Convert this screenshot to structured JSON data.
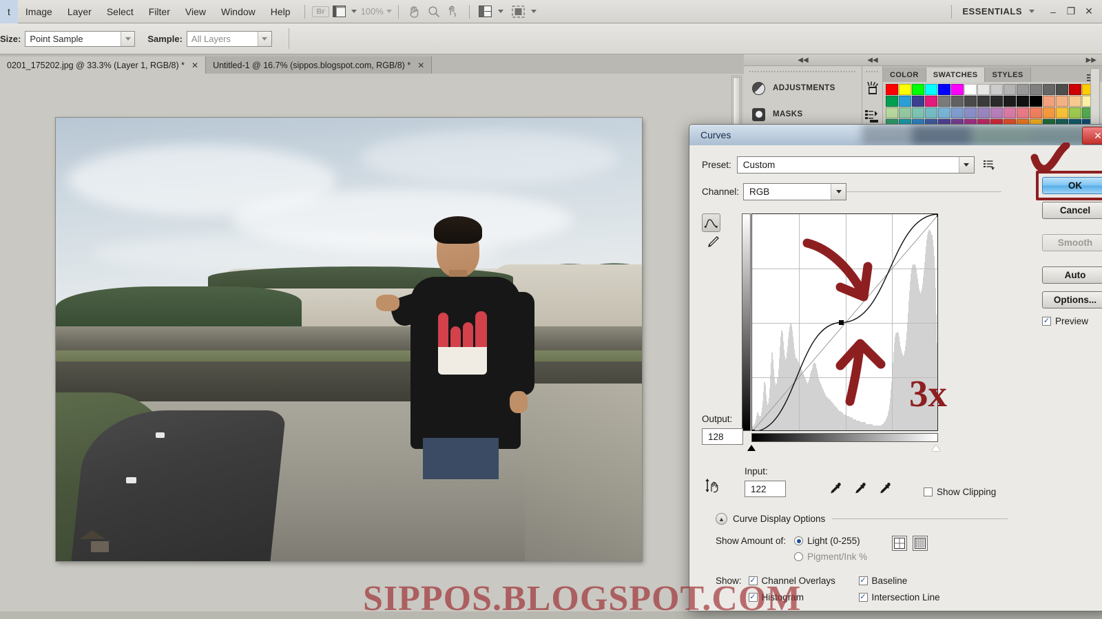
{
  "app": {
    "menu_items": [
      "t",
      "Image",
      "Layer",
      "Select",
      "Filter",
      "View",
      "Window",
      "Help"
    ],
    "bridge_badge": "Br",
    "zoom_level": "100%",
    "workspace": "ESSENTIALS",
    "window_buttons": {
      "minimize": "–",
      "restore": "❐",
      "close": "✕"
    }
  },
  "options_bar": {
    "sample_size_label": "Size:",
    "sample_size_value": "Point Sample",
    "sample_label": "Sample:",
    "sample_value": "All Layers"
  },
  "document_tabs": [
    {
      "label": "0201_175202.jpg @ 33.3% (Layer 1, RGB/8) *",
      "close": "✕",
      "active": true
    },
    {
      "label": "Untitled-1 @ 16.7% (sippos.blogspot.com, RGB/8) *",
      "close": "✕",
      "active": false
    }
  ],
  "watermark": "SIPPOS.BLOGSPOT.COM",
  "panels": {
    "icon_items": [
      {
        "label": "ADJUSTMENTS",
        "icon": "adjustments-icon"
      },
      {
        "label": "MASKS",
        "icon": "masks-icon"
      }
    ],
    "tool_icons": [
      "brushes-icon",
      "tool-presets-icon"
    ],
    "swatch_tabs": [
      "COLOR",
      "SWATCHES",
      "STYLES"
    ],
    "active_swatch_tab": "SWATCHES",
    "collapse_arrows": "◀◀",
    "expand_arrows": "▶▶",
    "panel_menu": "≡",
    "swatch_rows": [
      [
        "#ff0000",
        "#ffff00",
        "#00ff00",
        "#00ffff",
        "#0000ff",
        "#ff00ff",
        "#ffffff",
        "#e6e6e6",
        "#cccccc",
        "#b3b3b3",
        "#999999",
        "#808080",
        "#666666",
        "#4d4d4d",
        "#cc0000",
        "#ffcc00"
      ],
      [
        "#009e4f",
        "#2a9fd6",
        "#3b3f8f",
        "#e5197b",
        "#7a7a7a",
        "#616161",
        "#4a4a4a",
        "#3a3a3a",
        "#2b2b2b",
        "#1c1c1c",
        "#111111",
        "#000000",
        "#f4a07a",
        "#f3b184",
        "#f6c98f",
        "#fbf0a4"
      ],
      [
        "#b9d8a0",
        "#93c9a1",
        "#7fc4b2",
        "#74bcc6",
        "#79b3d6",
        "#7f9ed0",
        "#8a8fc8",
        "#9c86c0",
        "#b87fba",
        "#d97ba5",
        "#e87a86",
        "#ef7f5e",
        "#f79a3d",
        "#f7c13a",
        "#9ec94e",
        "#53a851"
      ],
      [
        "#2e9e6b",
        "#1c9fae",
        "#2f85c4",
        "#3f5fa8",
        "#51449c",
        "#7b3f9c",
        "#a8338c",
        "#c42a6a",
        "#d62b3a",
        "#e8522a",
        "#f07c22",
        "#f4b223",
        "#1f6e3a",
        "#17625a",
        "#125e6e",
        "#0f4e74"
      ]
    ]
  },
  "curves_dialog": {
    "title": "Curves",
    "close": "✕",
    "preset_label": "Preset:",
    "preset_value": "Custom",
    "preset_menu_icon": "preset-menu-icon",
    "channel_label": "Channel:",
    "channel_value": "RGB",
    "output_label": "Output:",
    "output_value": "128",
    "input_label": "Input:",
    "input_value": "122",
    "show_clipping_label": "Show Clipping",
    "show_clipping_checked": false,
    "curve_tool_icon": "curve-edit-icon",
    "pencil_tool_icon": "pencil-draw-icon",
    "target_adjust_icon": "target-adjustment-icon",
    "eyedroppers": [
      "black-point-eyedropper",
      "gray-point-eyedropper",
      "white-point-eyedropper"
    ],
    "curve_display_options_label": "Curve Display Options",
    "show_amount_label": "Show Amount of:",
    "amount_options": [
      {
        "label": "Light  (0-255)",
        "selected": true
      },
      {
        "label": "Pigment/Ink %",
        "selected": false
      }
    ],
    "grid_icons": [
      "quarter-grid-icon",
      "tenth-grid-icon"
    ],
    "show_label": "Show:",
    "show_checkboxes": [
      {
        "label": "Channel Overlays",
        "checked": true
      },
      {
        "label": "Baseline",
        "checked": true
      },
      {
        "label": "Histogram",
        "checked": true
      },
      {
        "label": "Intersection Line",
        "checked": true
      }
    ],
    "buttons": [
      {
        "label": "OK",
        "state": "default-highlighted"
      },
      {
        "label": "Cancel",
        "state": "normal"
      },
      {
        "label": "Smooth",
        "state": "disabled"
      },
      {
        "label": "Auto",
        "state": "normal"
      },
      {
        "label": "Options...",
        "state": "normal"
      }
    ],
    "preview_label": "Preview",
    "preview_checked": true,
    "annotation_text": "3x",
    "annotation_color": "#8e1f21"
  },
  "curve_data": {
    "type": "line",
    "xlabel": "Input",
    "ylabel": "Output",
    "xlim": [
      0,
      255
    ],
    "ylim": [
      0,
      255
    ],
    "grid": true,
    "grid_divisions": 4,
    "control_points": [
      {
        "input": 0,
        "output": 0
      },
      {
        "input": 122,
        "output": 128
      },
      {
        "input": 255,
        "output": 255
      }
    ],
    "baseline": {
      "from": [
        0,
        0
      ],
      "to": [
        255,
        255
      ]
    },
    "histogram": [
      2,
      3,
      3,
      4,
      5,
      7,
      9,
      11,
      10,
      9,
      8,
      9,
      11,
      14,
      18,
      24,
      30,
      28,
      22,
      18,
      16,
      15,
      17,
      20,
      26,
      34,
      42,
      48,
      44,
      38,
      33,
      30,
      28,
      27,
      29,
      33,
      38,
      45,
      52,
      58,
      62,
      60,
      55,
      50,
      46,
      44,
      43,
      45,
      48,
      52,
      57,
      61,
      64,
      66,
      65,
      62,
      58,
      54,
      50,
      47,
      45,
      44,
      43,
      42,
      41,
      40,
      39,
      38,
      37,
      36,
      35,
      34,
      33,
      32,
      31,
      30,
      29,
      29,
      30,
      31,
      33,
      35,
      37,
      39,
      41,
      42,
      42,
      41,
      39,
      37,
      35,
      33,
      31,
      30,
      29,
      28,
      27,
      26,
      25,
      24,
      23,
      22,
      21,
      21,
      20,
      20,
      19,
      19,
      18,
      18,
      17,
      17,
      16,
      16,
      15,
      15,
      14,
      14,
      13,
      13,
      12,
      12,
      12,
      11,
      11,
      11,
      10,
      10,
      10,
      10,
      9,
      9,
      9,
      9,
      8,
      8,
      8,
      8,
      8,
      7,
      7,
      7,
      7,
      7,
      6,
      6,
      6,
      6,
      6,
      6,
      5,
      5,
      5,
      5,
      5,
      5,
      5,
      4,
      4,
      4,
      4,
      4,
      4,
      4,
      4,
      4,
      4,
      3,
      3,
      3,
      3,
      3,
      3,
      3,
      3,
      3,
      3,
      3,
      3,
      3,
      4,
      4,
      4,
      5,
      5,
      6,
      7,
      8,
      9,
      11,
      13,
      16,
      20,
      25,
      30,
      36,
      42,
      48,
      54,
      58,
      60,
      61,
      60,
      58,
      55,
      52,
      50,
      48,
      47,
      46,
      46,
      47,
      49,
      52,
      56,
      61,
      67,
      73,
      80,
      86,
      92,
      97,
      100,
      102,
      103,
      103,
      102,
      100,
      97,
      94,
      91,
      88,
      86,
      85,
      85,
      86,
      88,
      91,
      95,
      99,
      104,
      109,
      114,
      118,
      121,
      123,
      124,
      124,
      123,
      121,
      118,
      114,
      108,
      100,
      88,
      72,
      54,
      36,
      20,
      10
    ],
    "histogram_max": 124
  }
}
